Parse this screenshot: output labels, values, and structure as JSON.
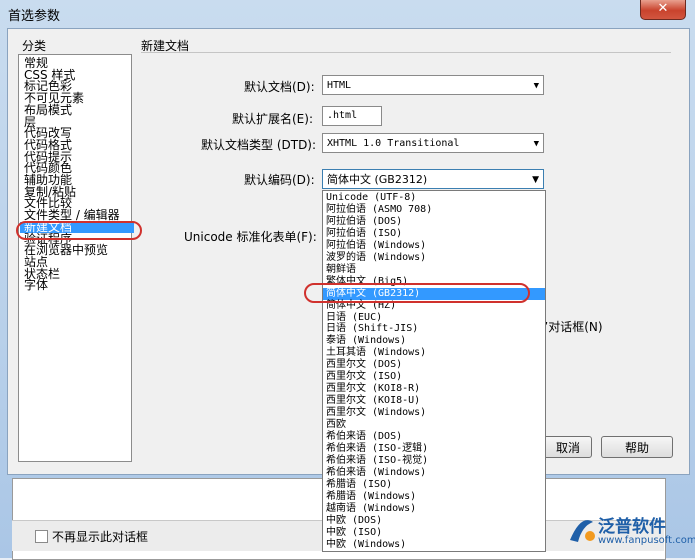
{
  "window": {
    "title": "首选参数",
    "close_glyph": "✕"
  },
  "categories": {
    "heading": "分类",
    "items": [
      "常规",
      "CSS 样式",
      "标记色彩",
      "不可见元素",
      "布局模式",
      "层",
      "代码改写",
      "代码格式",
      "代码提示",
      "代码颜色",
      "辅助功能",
      "复制/粘贴",
      "文件比较",
      "文件类型 / 编辑器",
      "新建文档",
      "验证程序",
      "在浏览器中预览",
      "站点",
      "状态栏",
      "字体"
    ],
    "selected": "新建文档"
  },
  "panel": {
    "title": "新建文档",
    "default_doc_label": "默认文档(D):",
    "default_doc_value": "HTML",
    "default_ext_label": "默认扩展名(E):",
    "default_ext_value": ".html",
    "default_doctype_label": "默认文档类型 (DTD):",
    "default_doctype_value": "XHTML 1.0 Transitional",
    "default_encoding_label": "默认编码(D):",
    "default_encoding_value": "简体中文 (GB2312)",
    "unicode_label": "Unicode 标准化表单(F):",
    "dialog_text_fragment": "”对话框(N)"
  },
  "encoding_options": [
    "Unicode (UTF-8)",
    "阿拉伯语 (ASMO 708)",
    "阿拉伯语 (DOS)",
    "阿拉伯语 (ISO)",
    "阿拉伯语 (Windows)",
    "波罗的语 (Windows)",
    "朝鲜语",
    "繁体中文 (Big5)",
    "简体中文 (GB2312)",
    "简体中文 (HZ)",
    "日语 (EUC)",
    "日语 (Shift-JIS)",
    "泰语 (Windows)",
    "土耳其语 (Windows)",
    "西里尔文 (DOS)",
    "西里尔文 (ISO)",
    "西里尔文 (KOI8-R)",
    "西里尔文 (KOI8-U)",
    "西里尔文 (Windows)",
    "西欧",
    "希伯来语 (DOS)",
    "希伯来语 (ISO-逻辑)",
    "希伯来语 (ISO-视觉)",
    "希伯来语 (Windows)",
    "希腊语 (ISO)",
    "希腊语 (Windows)",
    "越南语 (Windows)",
    "中欧 (DOS)",
    "中欧 (ISO)",
    "中欧 (Windows)"
  ],
  "selected_encoding": "简体中文 (GB2312)",
  "buttons": {
    "cancel": "取消",
    "help": "帮助"
  },
  "background_dialog": {
    "checkbox_label": "不再显示此对话框"
  },
  "watermark": {
    "brand": "泛普软件",
    "url": "www.fanpusoft.com"
  },
  "colors": {
    "selection": "#3399ff",
    "highlight_ring": "#d0312d",
    "brand": "#1f5fa8"
  }
}
